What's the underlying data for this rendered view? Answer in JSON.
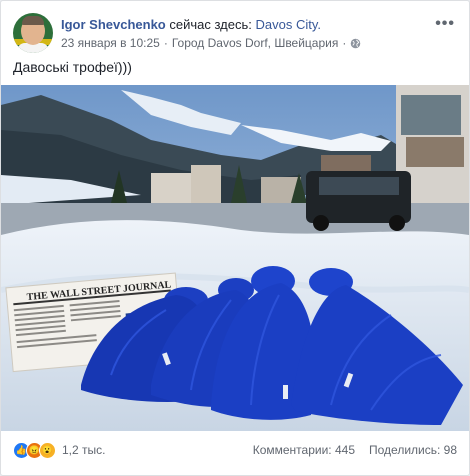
{
  "author": {
    "name": "Igor Shevchenko",
    "checkin_prefix": "сейчас здесь:",
    "place": "Davos City."
  },
  "meta": {
    "timestamp": "23 января в 10:25",
    "separator": "·",
    "location": "Город Davos Dorf, Швейцария",
    "separator2": "·"
  },
  "more_label": "•••",
  "post_text": "Давоські трофеї)))",
  "photo": {
    "newspaper_title": "THE WALL STREET JOURNAL",
    "subject": "four blue knit beanies on snow"
  },
  "footer": {
    "reaction_icons": [
      "like-icon",
      "angry-icon",
      "wow-icon"
    ],
    "reactions_count": "1,2 тыс.",
    "comments": "Комментарии: 445",
    "shares": "Поделились: 98"
  },
  "colors": {
    "link": "#385898",
    "text": "#1d2129",
    "muted": "#616770",
    "like": "#2078f4"
  }
}
